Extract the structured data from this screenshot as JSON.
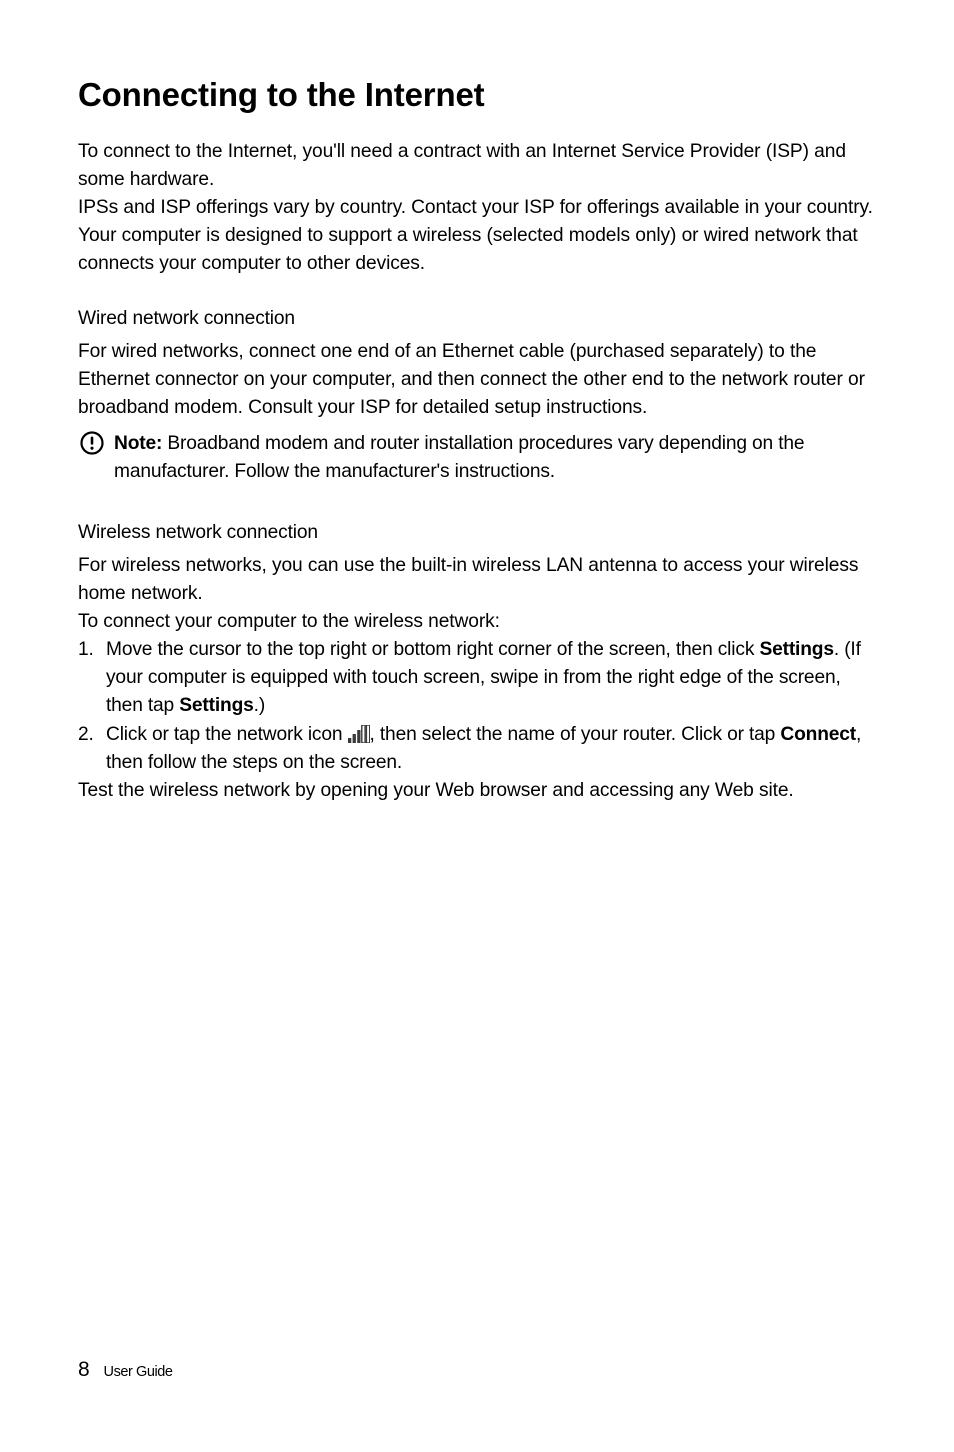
{
  "heading": "Connecting to the Internet",
  "intro": {
    "p1": "To connect to the Internet, you'll need a contract with an Internet Service Provider (ISP) and some hardware.",
    "p2": "IPSs and ISP offerings vary by country. Contact your ISP for offerings available in your country.",
    "p3": "Your computer is designed to support a wireless (selected models only) or wired network that connects your computer to other devices."
  },
  "wired": {
    "heading": "Wired network connection",
    "p1": "For wired networks, connect one end of an Ethernet cable (purchased separately) to the Ethernet connector on your computer, and then connect the other end to the network router or broadband modem. Consult your ISP for detailed setup instructions.",
    "note_label": "Note:",
    "note_text": " Broadband modem and router installation procedures vary depending on the manufacturer. Follow the manufacturer's instructions."
  },
  "wireless": {
    "heading": "Wireless network connection",
    "p1": "For wireless networks, you can use the built-in wireless LAN antenna to access your wireless home network.",
    "p2": "To connect your computer to the wireless network:",
    "step1_a": "Move the cursor to the top right or bottom right corner of the screen, then click ",
    "step1_bold1": "Settings",
    "step1_b": ". (If your computer is equipped with touch screen, swipe in from the right edge of the screen, then tap ",
    "step1_bold2": "Settings",
    "step1_c": ".)",
    "step2_a": "Click or tap the network icon ",
    "step2_b": ", then select the name of your router. Click or tap ",
    "step2_bold": "Connect",
    "step2_c": ", then follow the steps on the screen.",
    "p3": "Test the wireless network by opening your Web browser and accessing any Web site."
  },
  "footer": {
    "page": "8",
    "label": "User Guide"
  }
}
